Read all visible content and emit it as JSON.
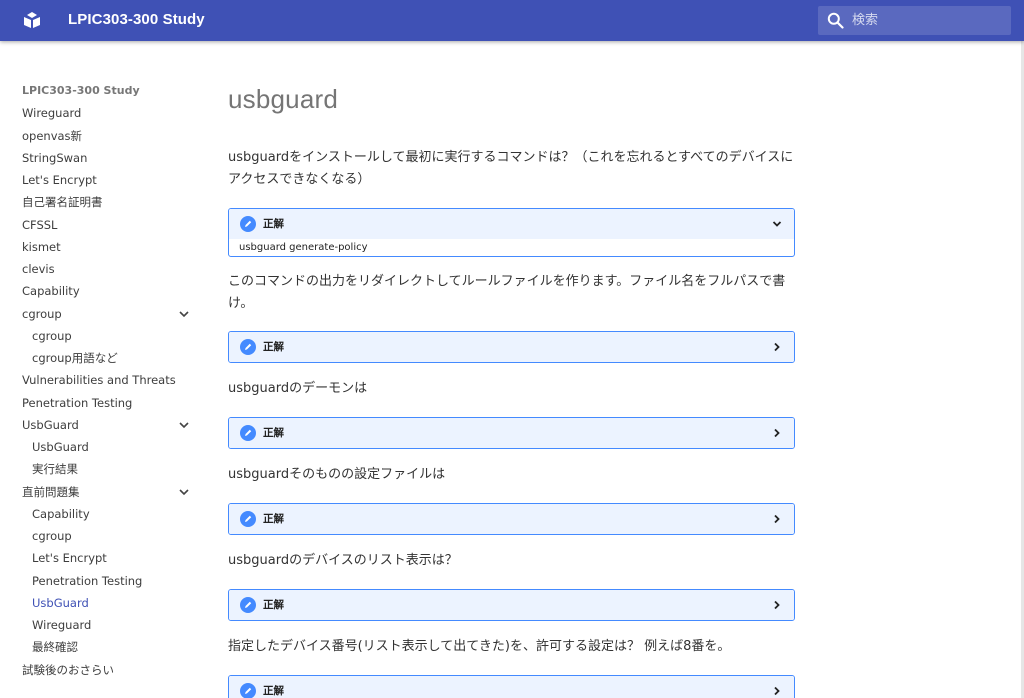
{
  "header": {
    "site_title": "LPIC303-300 Study",
    "search_placeholder": "検索",
    "logo_icon": "book-icon",
    "search_icon": "magnifier-icon",
    "brand_color": "#3f51b5"
  },
  "sidebar": {
    "title": "LPIC303-300 Study",
    "items": [
      {
        "label": "Wireguard"
      },
      {
        "label": "openvas新"
      },
      {
        "label": "StringSwan"
      },
      {
        "label": "Let's Encrypt"
      },
      {
        "label": "自己署名証明書"
      },
      {
        "label": "CFSSL"
      },
      {
        "label": "kismet"
      },
      {
        "label": "clevis"
      },
      {
        "label": "Capability"
      },
      {
        "label": "cgroup",
        "expanded": true
      },
      {
        "label": "cgroup"
      },
      {
        "label": "cgroup用語など"
      },
      {
        "label": "Vulnerabilities and Threats"
      },
      {
        "label": "Penetration Testing"
      },
      {
        "label": "UsbGuard",
        "expanded": true
      },
      {
        "label": "UsbGuard"
      },
      {
        "label": "実行結果"
      },
      {
        "label": "直前問題集",
        "expanded": true
      },
      {
        "label": "Capability"
      },
      {
        "label": "cgroup"
      },
      {
        "label": "Let's Encrypt"
      },
      {
        "label": "Penetration Testing"
      },
      {
        "label": "UsbGuard",
        "active": true
      },
      {
        "label": "Wireguard"
      },
      {
        "label": "最終確認"
      },
      {
        "label": "試験後のおさらい"
      }
    ]
  },
  "main": {
    "page_title": "usbguard",
    "answer_label": "正解",
    "questions": [
      {
        "text": "usbguardをインストールして最初に実行するコマンドは？（これを忘れるとすべてのデバイスにアクセスできなくなる）",
        "answer": "usbguard generate-policy",
        "expanded": true
      },
      {
        "text": "このコマンドの出力をリダイレクトしてルールファイルを作ります。ファイル名をフルパスで書け。",
        "answer": "",
        "expanded": false
      },
      {
        "text": "usbguardのデーモンは",
        "answer": "",
        "expanded": false
      },
      {
        "text": "usbguardそのものの設定ファイルは",
        "answer": "",
        "expanded": false
      },
      {
        "text": "usbguardのデバイスのリスト表示は？",
        "answer": "",
        "expanded": false
      },
      {
        "text": "指定したデバイス番号(リスト表示して出てきた)を、許可する設定は？ 例えば8番を。",
        "answer": "",
        "expanded": false
      }
    ]
  },
  "colors": {
    "answer_border": "#448aff",
    "answer_header_bg": "#ecf3ff",
    "active_link": "#3f51b5"
  }
}
